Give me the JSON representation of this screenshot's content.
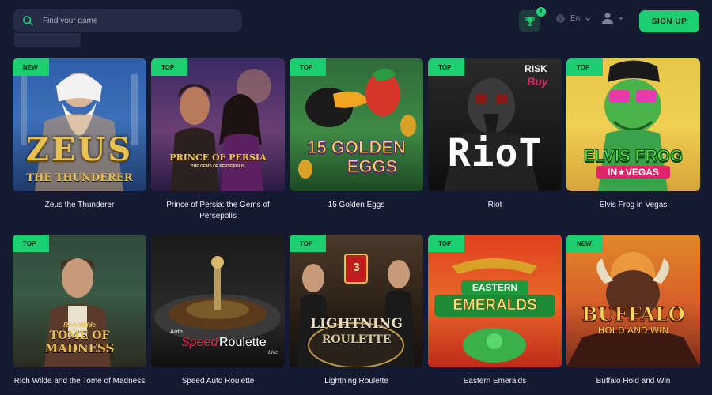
{
  "header": {
    "search_placeholder": "Find your game",
    "trophy_count": "1",
    "lang": "En",
    "signup_label": "SIGN UP"
  },
  "colors": {
    "background": "#151a33",
    "accent": "#1bcf71",
    "panel": "#262b45"
  },
  "games": [
    {
      "name": "Zeus the Thunderer",
      "badge": "NEW",
      "art_lines": [
        "ZEUS",
        "THE THUNDERER"
      ]
    },
    {
      "name": "Prince of Persia: the Gems of Persepolis",
      "badge": "TOP",
      "art_lines": [
        "PRINCE OF PERSIA",
        "THE GEMS OF PERSEPOLIS"
      ]
    },
    {
      "name": "15 Golden Eggs",
      "badge": "TOP",
      "art_lines": [
        "15 GOLDEN",
        "EGGS"
      ]
    },
    {
      "name": "Riot",
      "badge": "TOP",
      "art_lines": [
        "RISK",
        "Buy",
        "RioT"
      ]
    },
    {
      "name": "Elvis Frog in Vegas",
      "badge": "TOP",
      "art_lines": [
        "ELVIS FROG",
        "IN★VEGAS"
      ]
    },
    {
      "name": "Rich Wilde and the Tome of Madness",
      "badge": "TOP",
      "art_lines": [
        "Rich Wilde",
        "TOME OF",
        "MADNESS"
      ]
    },
    {
      "name": "Speed Auto Roulette",
      "badge": "",
      "art_lines": [
        "Auto",
        "Speed",
        "Roulette",
        "Live"
      ]
    },
    {
      "name": "Lightning Roulette",
      "badge": "TOP",
      "art_lines": [
        "LIGHTNING",
        "ROULETTE",
        "3"
      ]
    },
    {
      "name": "Eastern Emeralds",
      "badge": "TOP",
      "art_lines": [
        "EASTERN",
        "EMERALDS"
      ]
    },
    {
      "name": "Buffalo Hold and Win",
      "badge": "NEW",
      "art_lines": [
        "BUFFALO",
        "HOLD AND WIN"
      ]
    }
  ]
}
